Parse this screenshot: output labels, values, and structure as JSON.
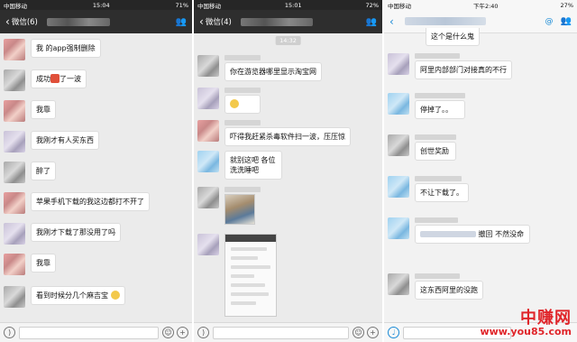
{
  "screens": [
    {
      "status": {
        "carrier": "中国移动",
        "time": "15:04",
        "battery": "71%"
      },
      "nav": {
        "back_label": "微信(6)"
      },
      "messages": [
        {
          "text": "我 的app强制删除"
        },
        {
          "text_before": "成功",
          "text_after": "了一波"
        },
        {
          "text": "我靠"
        },
        {
          "text": "我刚才有人买东西"
        },
        {
          "text": "醉了"
        },
        {
          "text": "苹果手机下载的我这边都打不开了"
        },
        {
          "text": "我刚才下载了那没用了吗"
        },
        {
          "text": "我靠"
        },
        {
          "text": "看到时候分几个麻吉宝"
        }
      ]
    },
    {
      "status": {
        "carrier": "中国移动",
        "time": "15:01",
        "battery": "72%"
      },
      "nav": {
        "back_label": "微信(4)"
      },
      "time_chip": "14:32",
      "messages": [
        {
          "text": "你在游览器哪里显示淘宝网"
        },
        {
          "text": "吓得我赶紧杀毒软件扫一波，压压惊"
        },
        {
          "text": "就别这吧 各位洗洗睡吧"
        }
      ]
    },
    {
      "status": {
        "carrier": "中国移动",
        "time": "下午2:40",
        "battery": "27%"
      },
      "top_text": "这个是什么鬼",
      "messages": [
        {
          "text": "阿里内部部门对接真的不行"
        },
        {
          "text": "停掉了。。"
        },
        {
          "text": "创世奖励"
        },
        {
          "text": "不让下载了。"
        },
        {
          "text_after": "撤回 不然没命"
        },
        {
          "text": "这东西阿里的没跑"
        }
      ]
    }
  ],
  "watermark": {
    "line1": "中赚网",
    "line2": "www.you85.com"
  }
}
